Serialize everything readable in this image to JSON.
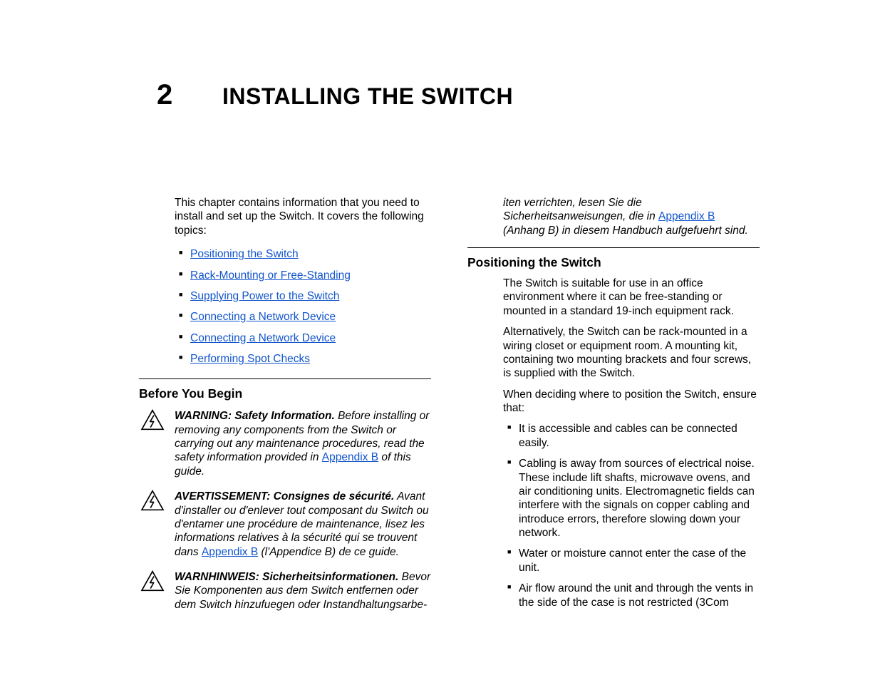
{
  "chapter": {
    "number": "2",
    "title": "INSTALLING THE SWITCH"
  },
  "intro": "This chapter contains information that you need to install and set up the Switch. It covers the following topics:",
  "toc": {
    "items": [
      {
        "label": "Positioning the Switch"
      },
      {
        "label": "Rack-Mounting or Free-Standing"
      },
      {
        "label": "Supplying Power to the Switch"
      },
      {
        "label": "Connecting a Network Device"
      },
      {
        "label": "Connecting a Network Device"
      },
      {
        "label": "Performing Spot Checks"
      }
    ]
  },
  "before": {
    "heading": "Before You Begin",
    "warnings": [
      {
        "lead": "WARNING: Safety Information.",
        "body_before_link": " Before installing or removing any components from the Switch or carrying out any maintenance procedures, read the safety information provided in ",
        "link": "Appendix B",
        "body_after_link": " of this guide."
      },
      {
        "lead": "AVERTISSEMENT: Consignes de sécurité.",
        "body_before_link": " Avant d'installer ou d'enlever tout composant du Switch ou d'entamer une procédure de maintenance, lisez les informations relatives à la sécurité qui se trouvent dans ",
        "link": "Appendix B",
        "body_after_link": " (l'Appendice B) de ce guide."
      },
      {
        "lead": "WARNHINWEIS: Sicherheitsinformationen.",
        "body_before_link": " Bevor Sie Komponenten aus dem Switch entfernen oder dem Switch hinzufuegen oder Instandhaltungsarbe-",
        "link": "",
        "body_after_link": ""
      }
    ]
  },
  "right_cont": {
    "before_link": "iten verrichten, lesen Sie die Sicherheitsanweisungen, die in ",
    "link": "Appendix B",
    "after_link": " (Anhang B) in diesem Handbuch aufgefuehrt sind."
  },
  "positioning": {
    "heading": "Positioning the Switch",
    "p1": "The Switch is suitable for use in an office environment where it can be free-standing or mounted in a standard 19-inch equipment rack.",
    "p2": "Alternatively, the Switch can be rack-mounted in a wiring closet or equipment room. A mounting kit, containing two mounting brackets and four screws, is supplied with the Switch.",
    "p3": "When deciding where to position the Switch, ensure that:",
    "bullets": [
      "It is accessible and cables can be connected easily.",
      "Cabling is away from sources of electrical noise. These include lift shafts, microwave ovens, and air conditioning units. Electromagnetic fields can interfere with the signals on copper cabling and introduce errors, therefore slowing down your network.",
      "Water or moisture cannot enter the case of the unit.",
      "Air flow around the unit and through the vents in the side of the case is not restricted (3Com"
    ]
  }
}
